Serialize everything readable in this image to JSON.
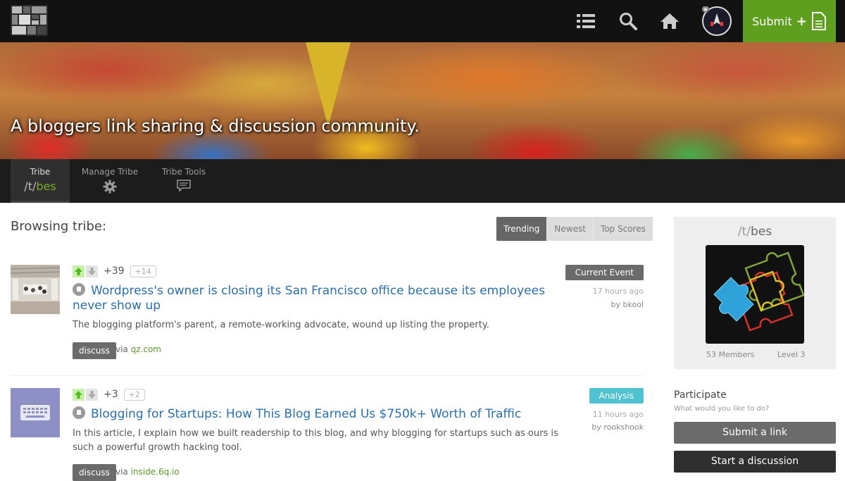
{
  "header": {
    "submit_label": "Submit",
    "submit_plus": "+",
    "icons": [
      "list-icon",
      "search-icon",
      "home-icon",
      "avatar",
      "submit-document-icon"
    ]
  },
  "banner": {
    "tagline": "A bloggers link sharing & discussion community."
  },
  "tribe_nav": {
    "tabs": [
      {
        "label": "Tribe",
        "prefix": "/t/",
        "name": "bes",
        "active": true
      },
      {
        "label": "Manage Tribe",
        "icon": "gear-icon"
      },
      {
        "label": "Tribe Tools",
        "icon": "chat-icon"
      }
    ]
  },
  "main": {
    "heading": "Browsing tribe:",
    "sort_options": [
      "Trending",
      "Newest",
      "Top Scores"
    ],
    "active_sort": "Trending",
    "posts": [
      {
        "score": "+39",
        "delta": "+14",
        "title_line1": "Wordpress's owner is closing its San Francisco office because its employees",
        "title_line2": "never show up",
        "description": "The blogging platform's parent, a remote-working advocate, wound up listing the property.",
        "discuss_label": "discuss",
        "via": "via",
        "domain": "qz.com",
        "tag": "Current Event",
        "time": "17 hours ago",
        "by": "by bkool"
      },
      {
        "score": "+3",
        "delta": "+2",
        "title_line1": "Blogging for Startups: How This Blog Earned Us $750k+ Worth of Traffic",
        "description_line1": "In this article, I explain how we built readership to this blog, and why blogging for startups such as ours is",
        "description_line2": "such a powerful growth hacking tool.",
        "discuss_label": "discuss",
        "via": "via",
        "domain": "inside.6q.io",
        "tag": "Analysis",
        "time": "11 hours ago",
        "by": "by rookshook"
      }
    ]
  },
  "sidebar": {
    "prefix": "/t/",
    "name": "bes",
    "members": "53 Members",
    "level": "Level 3",
    "participate_title": "Participate",
    "participate_sub": "What would you like to do?",
    "submit_link": "Submit a link",
    "start_discussion": "Start a discussion"
  },
  "colors": {
    "accent_green": "#5f9f1f",
    "link_blue": "#2a6fae",
    "analysis_tag": "#4fc2d0"
  }
}
